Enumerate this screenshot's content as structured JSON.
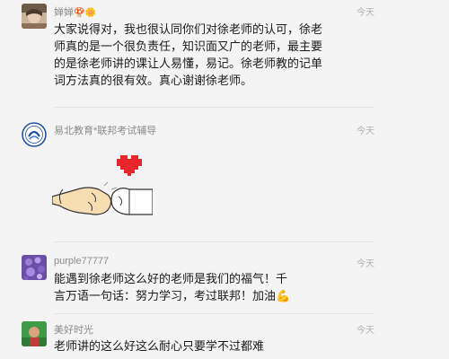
{
  "comments": [
    {
      "name": "婵婵",
      "name_emoji": "🍄🌼",
      "time": "今天",
      "text": "大家说得对，我也很认同你们对徐老师的认可，徐老师真的是一个很负责任，知识面又广的老师，最主要的是徐老师讲的课让人易懂，易记。徐老师教的记单词方法真的很有效。真心谢谢徐老师。"
    },
    {
      "name": "易北教育*联邦考试辅导",
      "time": "今天",
      "image": "fist-bump-heart-illustration"
    },
    {
      "name": "purple77777",
      "time": "今天",
      "text": "能遇到徐老师这么好的老师是我们的福气！千言万语一句话：努力学习，考过联邦！加油💪"
    },
    {
      "name": "美好时光",
      "time": "今天",
      "text": "老师讲的这么好这么耐心只要学不过都难"
    }
  ],
  "colors": {
    "background": "#f4f4f4",
    "name_text": "#8a8a8a",
    "time_text": "#b0b0b0",
    "heart": "#e8262b"
  }
}
